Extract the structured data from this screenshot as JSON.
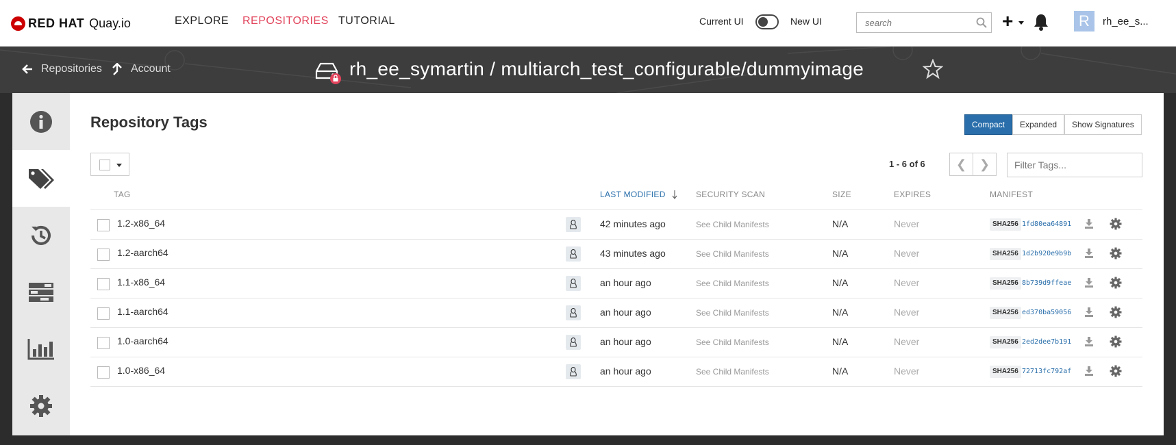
{
  "nav": {
    "brand_red_hat": "RED HAT",
    "brand_quay": "Quay.io",
    "links": [
      "EXPLORE",
      "REPOSITORIES",
      "TUTORIAL"
    ],
    "active_link": "REPOSITORIES",
    "toggle_left_label": "Current UI",
    "toggle_right_label": "New UI",
    "search_placeholder": "search",
    "avatar_letter": "R",
    "username": "rh_ee_s..."
  },
  "header": {
    "back_link": "Repositories",
    "account_link": "Account",
    "repo_title": "rh_ee_symartin / multiarch_test_configurable/dummyimage"
  },
  "sidebar": {
    "items": [
      "info-icon",
      "tags-icon",
      "history-icon",
      "builds-icon",
      "usage-logs-icon",
      "settings-icon"
    ],
    "active": "tags-icon"
  },
  "main": {
    "title": "Repository Tags",
    "view_buttons": [
      "Compact",
      "Expanded"
    ],
    "active_view": "Compact",
    "show_signatures": "Show Signatures",
    "pager_text": "1 - 6 of 6",
    "filter_placeholder": "Filter Tags...",
    "columns": {
      "tag": "TAG",
      "last_modified": "LAST MODIFIED",
      "security_scan": "SECURITY SCAN",
      "size": "SIZE",
      "expires": "EXPIRES",
      "manifest": "MANIFEST"
    },
    "rows": [
      {
        "tag": "1.2-x86_64",
        "modified": "42 minutes ago",
        "scan": "See Child Manifests",
        "size": "N/A",
        "expires": "Never",
        "sha": "SHA256",
        "digest": "1fd80ea64891"
      },
      {
        "tag": "1.2-aarch64",
        "modified": "43 minutes ago",
        "scan": "See Child Manifests",
        "size": "N/A",
        "expires": "Never",
        "sha": "SHA256",
        "digest": "1d2b920e9b9b"
      },
      {
        "tag": "1.1-x86_64",
        "modified": "an hour ago",
        "scan": "See Child Manifests",
        "size": "N/A",
        "expires": "Never",
        "sha": "SHA256",
        "digest": "8b739d9ffeae"
      },
      {
        "tag": "1.1-aarch64",
        "modified": "an hour ago",
        "scan": "See Child Manifests",
        "size": "N/A",
        "expires": "Never",
        "sha": "SHA256",
        "digest": "ed370ba59056"
      },
      {
        "tag": "1.0-aarch64",
        "modified": "an hour ago",
        "scan": "See Child Manifests",
        "size": "N/A",
        "expires": "Never",
        "sha": "SHA256",
        "digest": "2ed2dee7b191"
      },
      {
        "tag": "1.0-x86_64",
        "modified": "an hour ago",
        "scan": "See Child Manifests",
        "size": "N/A",
        "expires": "Never",
        "sha": "SHA256",
        "digest": "72713fc792af"
      }
    ]
  },
  "colors": {
    "accent": "#e2445c",
    "primary": "#2a6fab",
    "header_bg": "#3d3d3d"
  }
}
